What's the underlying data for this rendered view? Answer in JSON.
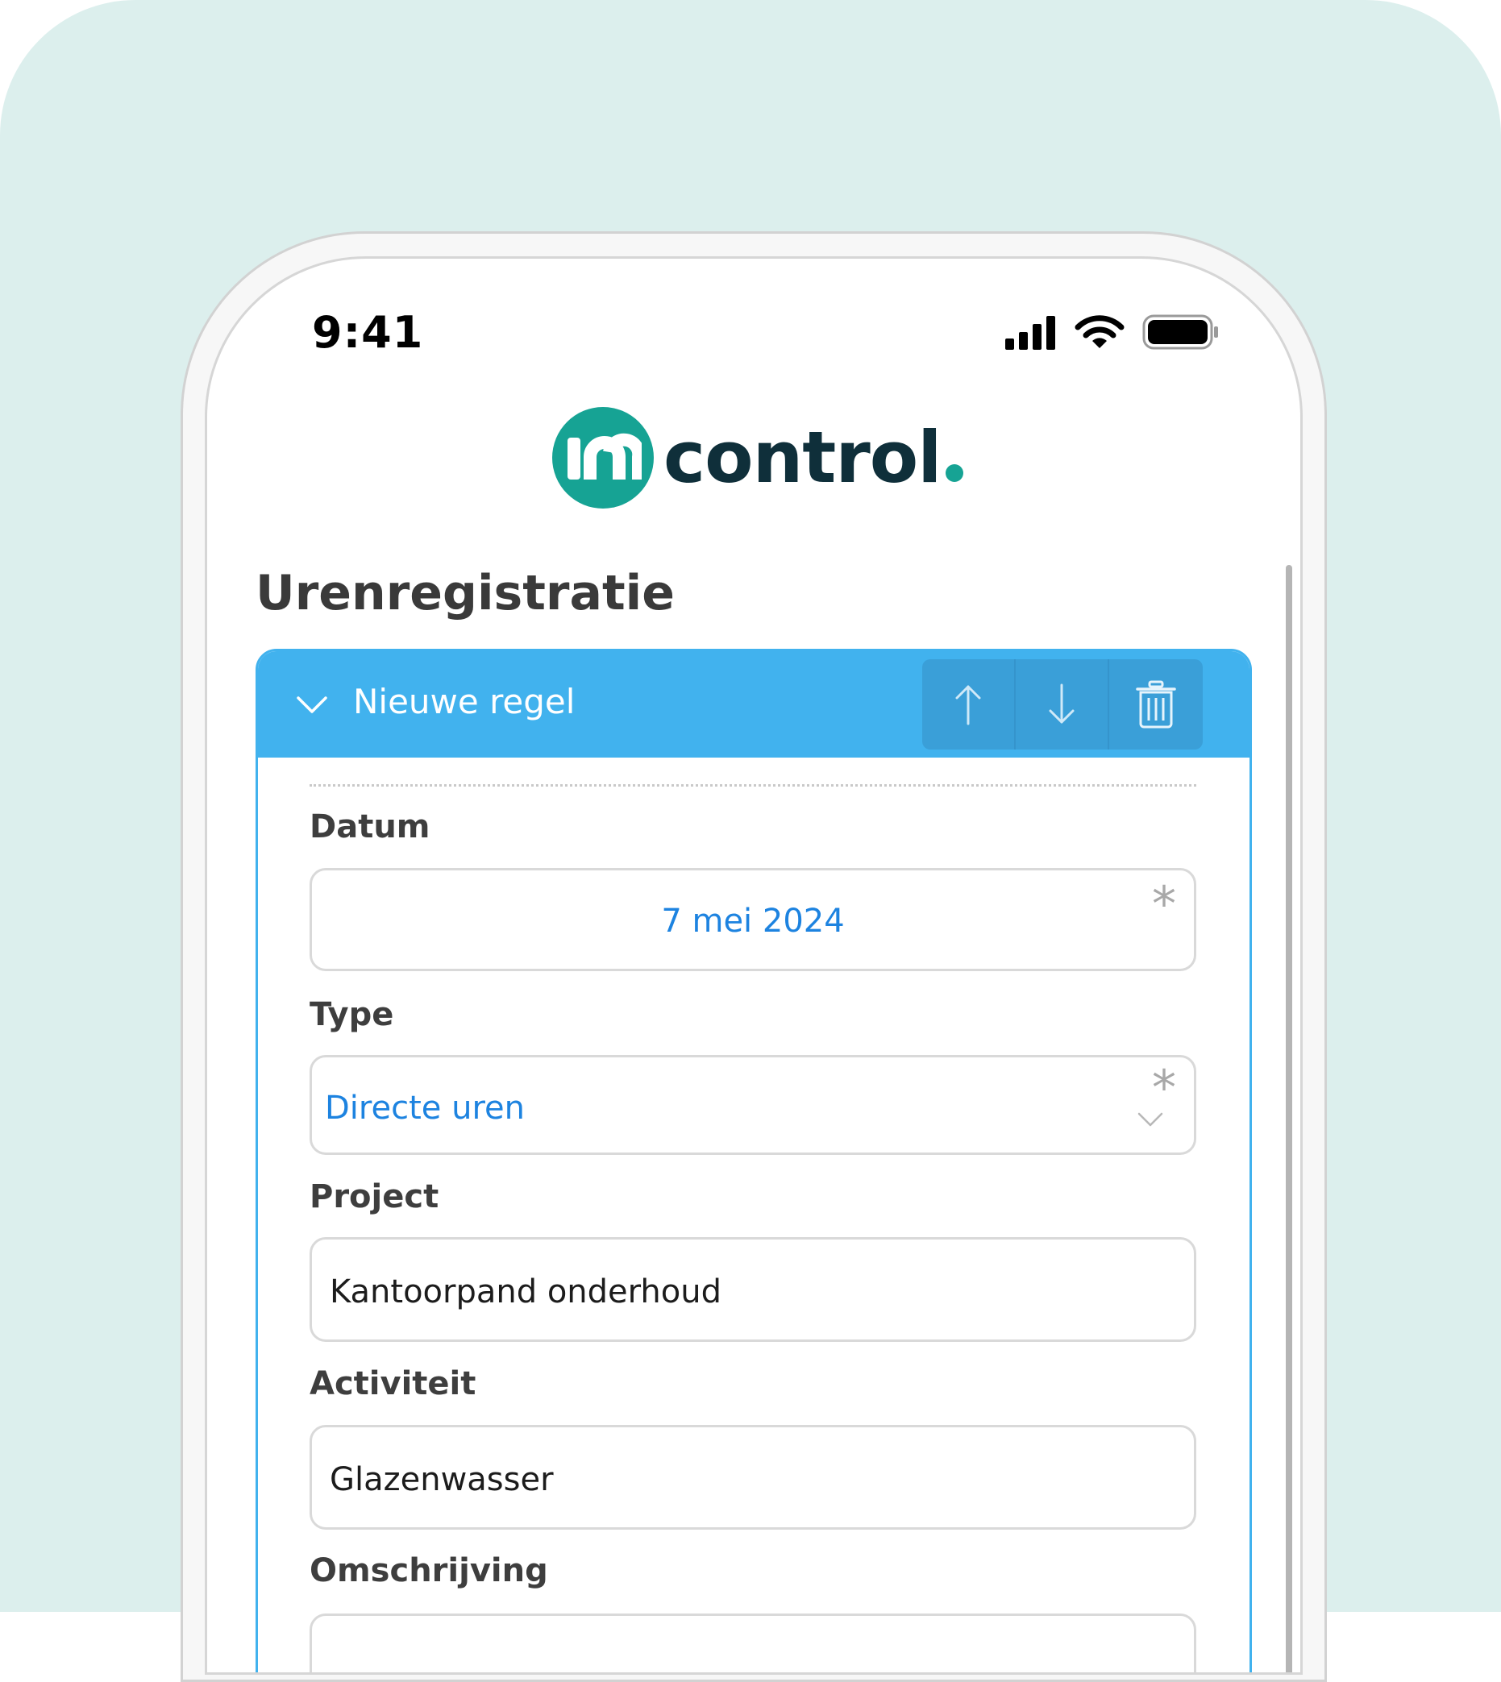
{
  "status_bar": {
    "time": "9:41",
    "icons": [
      "cellular-signal-icon",
      "wifi-icon",
      "battery-icon"
    ]
  },
  "logo": {
    "mark_text": "in",
    "text": "control"
  },
  "page": {
    "title": "Urenregistratie"
  },
  "card": {
    "title": "Nieuwe regel",
    "actions": [
      "arrow-up-icon",
      "arrow-down-icon",
      "trash-icon"
    ]
  },
  "fields": {
    "datum": {
      "label": "Datum",
      "value": "7 mei 2024",
      "required": "*"
    },
    "type": {
      "label": "Type",
      "value": "Directe uren",
      "required": "*"
    },
    "project": {
      "label": "Project",
      "value": "Kantoorpand onderhoud"
    },
    "activiteit": {
      "label": "Activiteit",
      "value": "Glazenwasser"
    },
    "omschrijving": {
      "label": "Omschrijving"
    }
  },
  "colors": {
    "backdrop": "#dcefed",
    "brand_teal": "#16a394",
    "brand_dark": "#0f2f3a",
    "accent_blue": "#41b2ee",
    "value_blue": "#1d83e0"
  }
}
